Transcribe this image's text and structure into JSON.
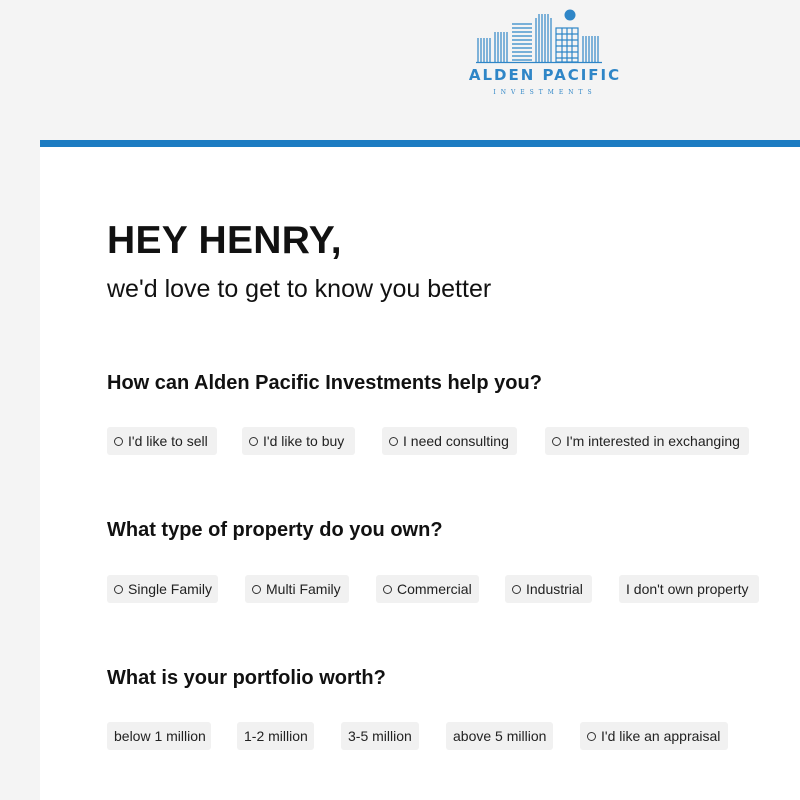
{
  "brand": {
    "name": "ALDEN PACIFIC",
    "tagline": "INVESTMENTS",
    "accent_color": "#1d7cc2",
    "logo_color": "#2f86c7"
  },
  "greeting": "HEY HENRY,",
  "subtitle": "we'd love to get to know you better",
  "questions": [
    {
      "title": "How can Alden Pacific Investments help you?",
      "options": [
        {
          "label": "I'd like to sell",
          "radio": true
        },
        {
          "label": "I'd like to buy",
          "radio": true
        },
        {
          "label": "I need consulting",
          "radio": true
        },
        {
          "label": "I'm interested in exchanging",
          "radio": true
        }
      ]
    },
    {
      "title": "What type of property do you own?",
      "options": [
        {
          "label": "Single Family",
          "radio": true
        },
        {
          "label": "Multi Family",
          "radio": true
        },
        {
          "label": "Commercial",
          "radio": true
        },
        {
          "label": "Industrial",
          "radio": true
        },
        {
          "label": "I don't own property",
          "radio": false
        }
      ]
    },
    {
      "title": "What is your portfolio worth?",
      "options": [
        {
          "label": "below 1 million",
          "radio": false
        },
        {
          "label": "1-2 million",
          "radio": false
        },
        {
          "label": "3-5 million",
          "radio": false
        },
        {
          "label": "above 5 million",
          "radio": false
        },
        {
          "label": "I'd like an appraisal",
          "radio": true
        }
      ]
    }
  ]
}
